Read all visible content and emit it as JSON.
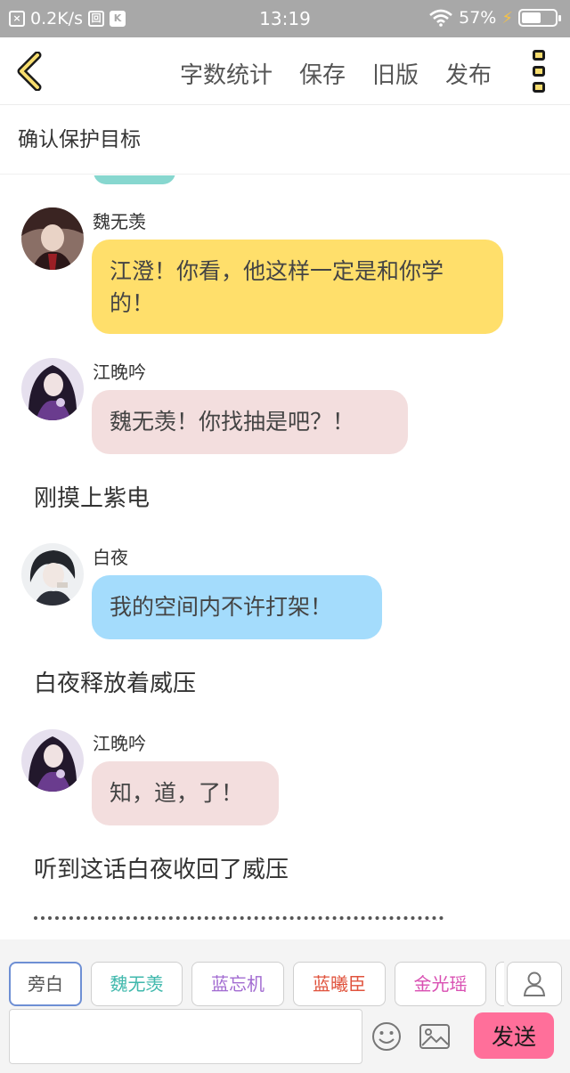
{
  "status_bar": {
    "speed": "0.2K/s",
    "icon_a": "×",
    "icon_b": "回",
    "icon_c": "K",
    "time": "13:19",
    "battery": "57%",
    "battery_level": 0.57
  },
  "header": {
    "actions": [
      "字数统计",
      "保存",
      "旧版",
      "发布"
    ]
  },
  "subtitle": "确认保护目标",
  "colors": {
    "accent": "#f7dd6e",
    "bubble_yellow": "#ffdf6b",
    "bubble_pink": "#f3dede",
    "bubble_blue": "#a4dcfc",
    "send": "#ff6f9a",
    "chip_teal": "#3fb8ac",
    "chip_purple": "#a26bd1",
    "chip_red": "#e0533d",
    "chip_magenta": "#d94fb2"
  },
  "messages": [
    {
      "type": "chat",
      "name": "魏无羡",
      "text": "江澄！你看，他这样一定是和你学的！",
      "color": "#ffdf6b",
      "avatar_icon": "character-avatar"
    },
    {
      "type": "chat",
      "name": "江晚吟",
      "text": "魏无羡！你找抽是吧？！",
      "color": "#f3dede",
      "avatar_icon": "character-avatar"
    },
    {
      "type": "narration",
      "text": "刚摸上紫电"
    },
    {
      "type": "chat",
      "name": "白夜",
      "text": "我的空间内不许打架！",
      "color": "#a4dcfc",
      "avatar_icon": "character-avatar"
    },
    {
      "type": "narration",
      "text": "白夜释放着威压"
    },
    {
      "type": "chat",
      "name": "江晚吟",
      "text": "知，道，了！",
      "color": "#f3dede",
      "avatar_icon": "character-avatar"
    },
    {
      "type": "narration",
      "text": "听到这话白夜收回了威压"
    }
  ],
  "character_bar": {
    "chips": [
      {
        "label": "旁白",
        "color": "#555555",
        "active": true
      },
      {
        "label": "魏无羡",
        "color": "#3fb8ac"
      },
      {
        "label": "蓝忘机",
        "color": "#a26bd1"
      },
      {
        "label": "蓝曦臣",
        "color": "#e0533d"
      },
      {
        "label": "金光瑶",
        "color": "#d94fb2"
      }
    ]
  },
  "input": {
    "value": "",
    "send_label": "发送"
  }
}
